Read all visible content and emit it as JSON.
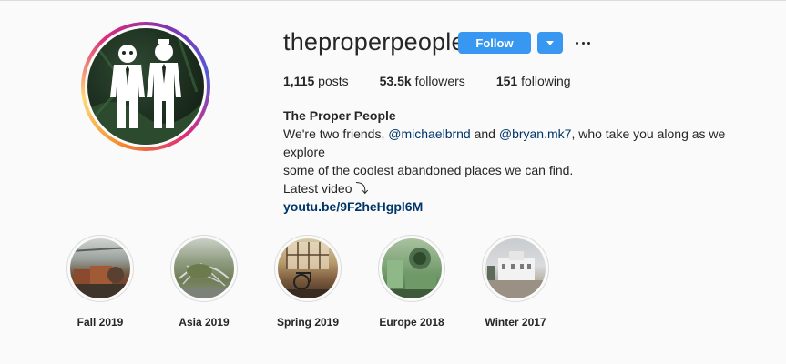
{
  "profile": {
    "username": "theproperpeople",
    "follow_label": "Follow",
    "stats": {
      "posts_count": "1,115",
      "posts_label": "posts",
      "followers_count": "53.5k",
      "followers_label": "followers",
      "following_count": "151",
      "following_label": "following"
    },
    "bio": {
      "name": "The Proper People",
      "line1_prefix": "We're two friends, ",
      "mention1": "@michaelbrnd",
      "line1_mid": " and ",
      "mention2": "@bryan.mk7",
      "line1_suffix": ", who take you along as we explore",
      "line2": "some of the coolest abandoned places we can find.",
      "line3": "Latest video ⤵",
      "link": "youtu.be/9F2heHgpl6M"
    }
  },
  "highlights": [
    {
      "label": "Fall 2019"
    },
    {
      "label": "Asia 2019"
    },
    {
      "label": "Spring 2019"
    },
    {
      "label": "Europe 2018"
    },
    {
      "label": "Winter 2017"
    }
  ],
  "colors": {
    "accent": "#3897f0",
    "link": "#003569",
    "text": "#262626",
    "background": "#fafafa"
  }
}
